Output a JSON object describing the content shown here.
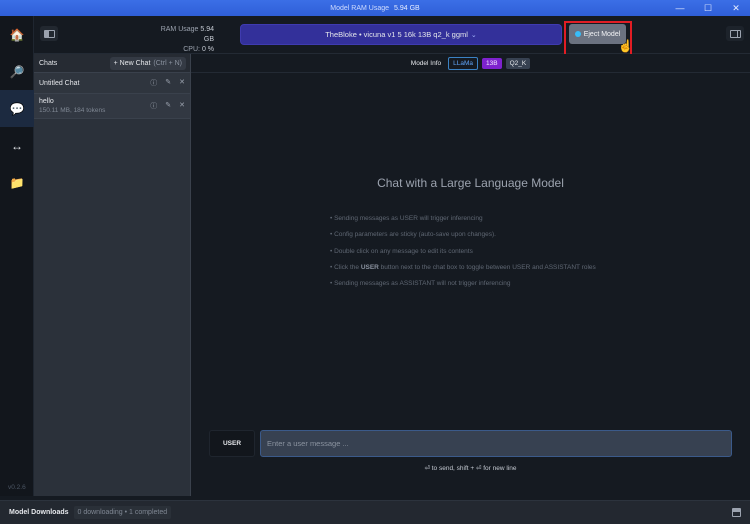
{
  "titlebar": {
    "label": "Model RAM Usage",
    "value": "5.94 GB",
    "minimize": "—",
    "maximize": "☐",
    "close": "✕"
  },
  "nav": {
    "items": [
      {
        "name": "home",
        "icon": "🏠",
        "active": false
      },
      {
        "name": "search",
        "icon": "🔎",
        "active": false
      },
      {
        "name": "chat",
        "icon": "💬",
        "active": true
      },
      {
        "name": "server",
        "icon": "↔",
        "active": false
      },
      {
        "name": "folder",
        "icon": "📁",
        "active": false
      }
    ],
    "version": "v0.2.6"
  },
  "topbar": {
    "ram_label": "RAM Usage",
    "ram_value": "5.94 GB",
    "cpu_label": "CPU:",
    "cpu_value": "0 %",
    "model_name": "TheBloke • vicuna v1 5 16k 13B q2_k ggml",
    "model_chevron": "⌄",
    "eject_label": "Eject Model"
  },
  "chats": {
    "title": "Chats",
    "new_chat_label": "+ New Chat",
    "new_chat_shortcut": "(Ctrl + N)",
    "items": [
      {
        "name": "Untitled Chat",
        "meta": ""
      },
      {
        "name": "hello",
        "meta": "150.11 MB, 184 tokens"
      }
    ],
    "action_icons": {
      "info": "ⓘ",
      "edit": "✎",
      "delete": "✕"
    }
  },
  "main": {
    "model_info_label": "Model Info",
    "badges": {
      "arch": "LLaMa",
      "size": "13B",
      "quant": "Q2_K"
    },
    "hero_title": "Chat with a Large Language Model",
    "tips": [
      {
        "pre": "• Sending messages as USER will trigger inferencing",
        "bold": "",
        "post": ""
      },
      {
        "pre": "• Config parameters are sticky (auto-save upon changes).",
        "bold": "",
        "post": ""
      },
      {
        "pre": "• Double click on any message to edit its contents",
        "bold": "",
        "post": ""
      },
      {
        "pre": "• Click the ",
        "bold": "USER",
        "post": " button next to the chat box to toggle between USER and ASSISTANT roles"
      },
      {
        "pre": "• Sending messages as ASSISTANT will not trigger inferencing",
        "bold": "",
        "post": ""
      }
    ],
    "role_label": "USER",
    "input_placeholder": "Enter a user message ...",
    "input_value": "",
    "hint": "⏎ to send, shift + ⏎ for new line"
  },
  "bottombar": {
    "title": "Model Downloads",
    "status": "0 downloading • 1 completed"
  }
}
